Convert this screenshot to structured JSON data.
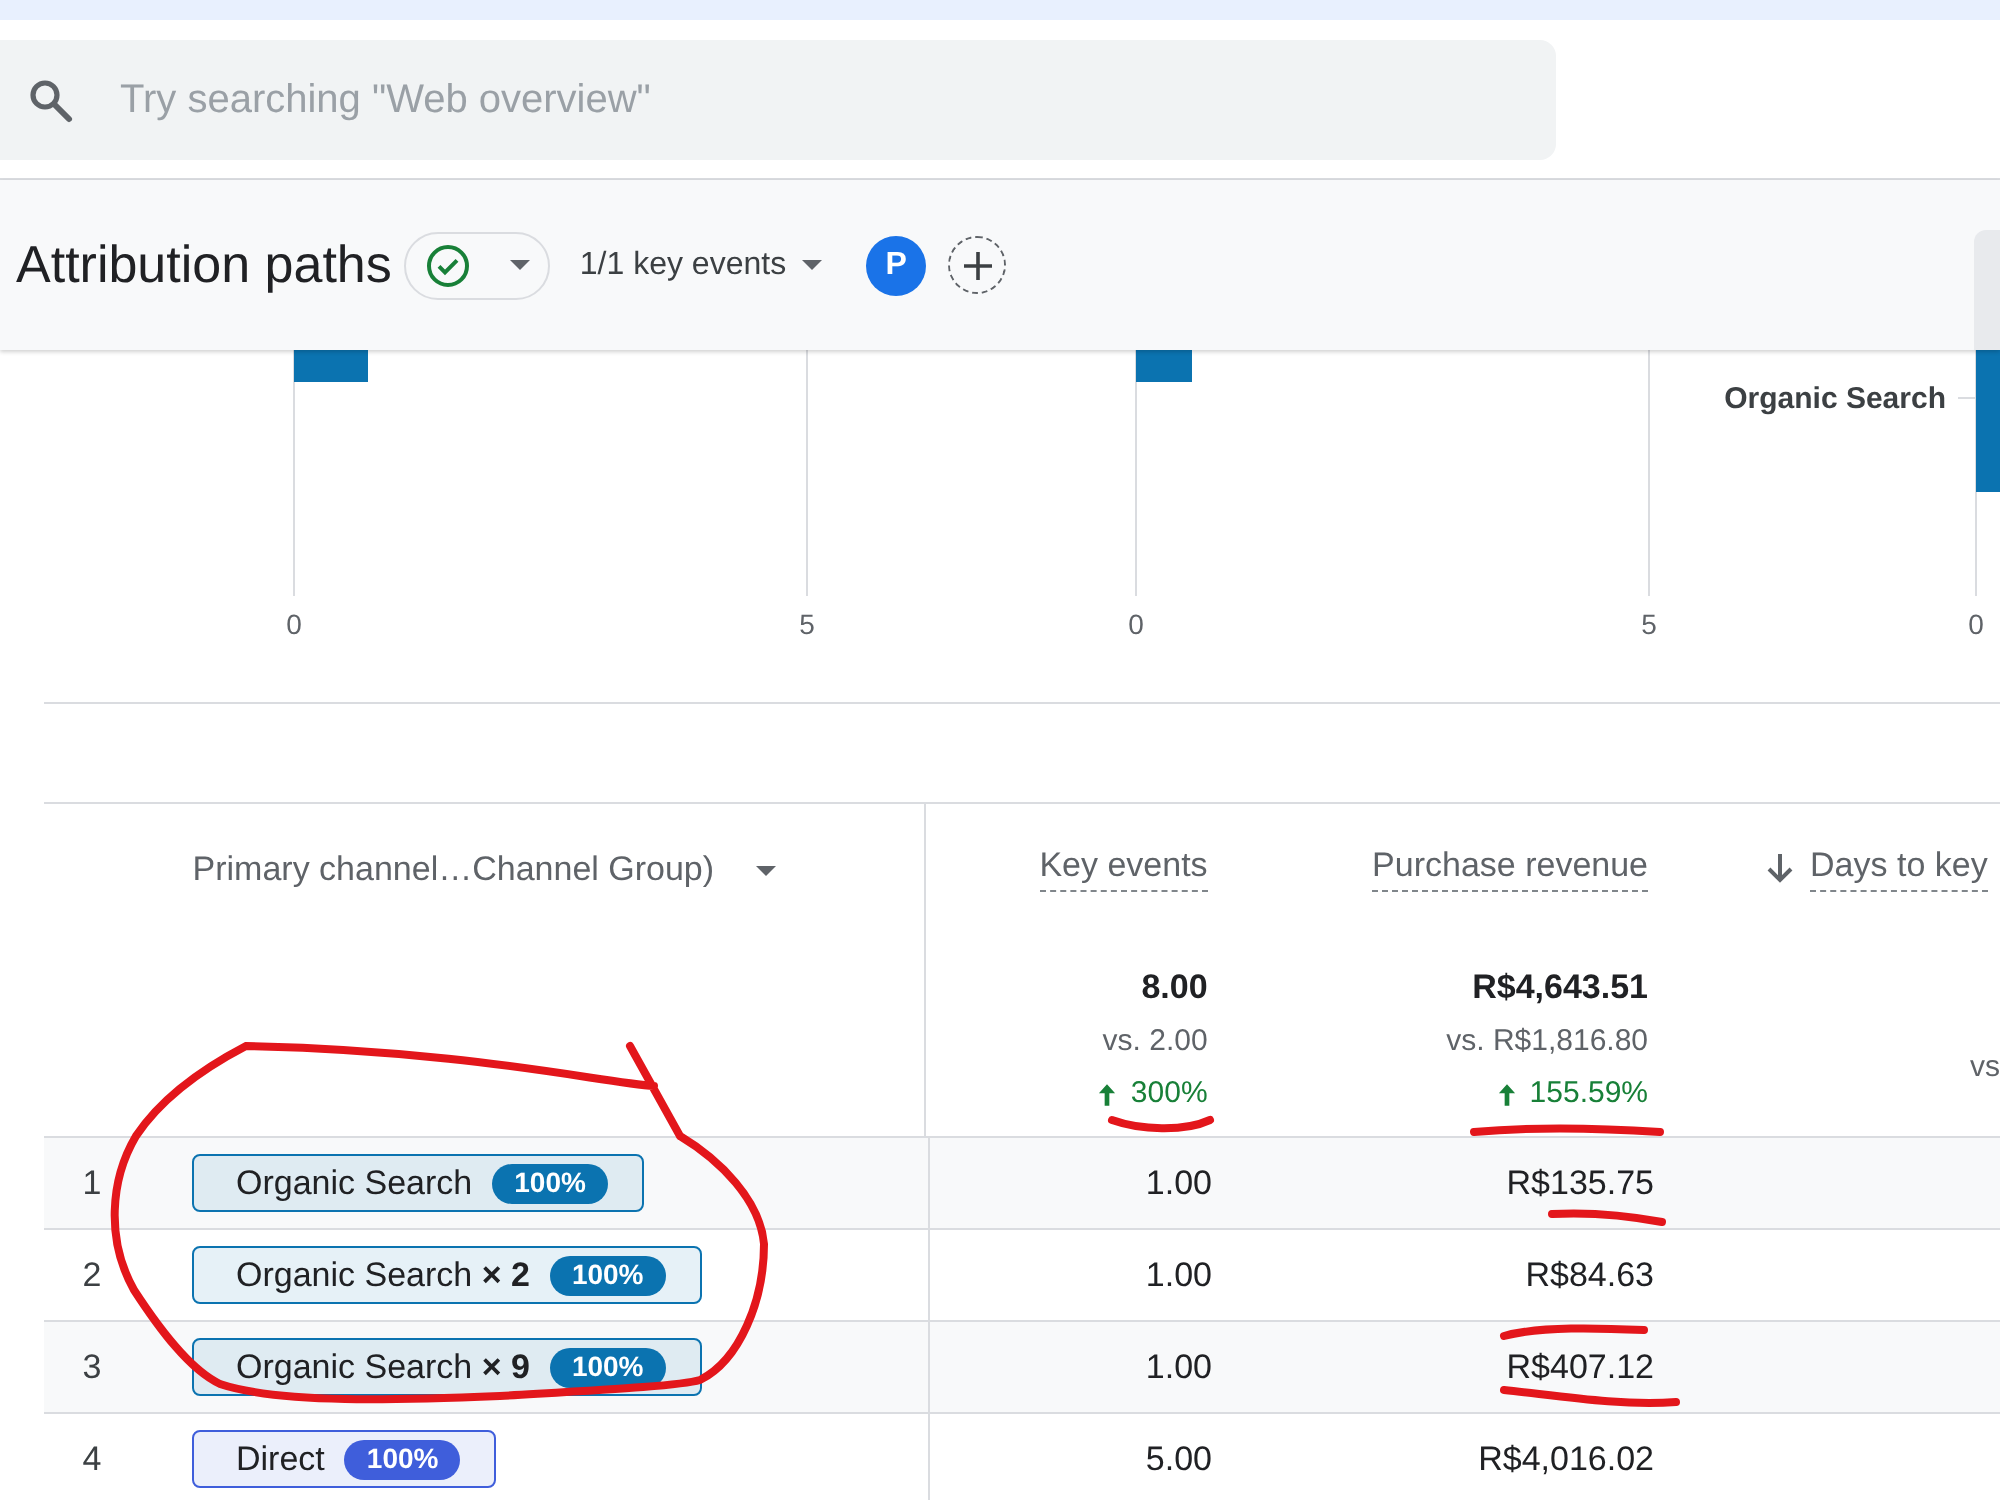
{
  "search": {
    "placeholder": "Try searching \"Web overview\""
  },
  "header": {
    "title": "Attribution paths",
    "key_events_filter": "1/1 key events",
    "comparison_avatar": "P"
  },
  "chart": {
    "panels": [
      {
        "ticks": [
          "0",
          "5"
        ]
      },
      {
        "ticks": [
          "0",
          "5"
        ]
      },
      {
        "ticks": [
          "0"
        ],
        "category_label": "Organic Search"
      }
    ]
  },
  "table": {
    "columns": [
      {
        "kind": "dimension",
        "label": "Primary channel…Channel Group)",
        "sorted": false
      },
      {
        "kind": "metric",
        "label": "Key events",
        "sorted": false,
        "total": {
          "value": "8.00",
          "compare": "vs. 2.00",
          "change": "300%",
          "increase": true
        }
      },
      {
        "kind": "metric",
        "label": "Purchase revenue",
        "sorted": false,
        "total": {
          "value": "R$4,643.51",
          "compare": "vs. R$1,816.80",
          "change": "155.59%",
          "increase": true
        }
      },
      {
        "kind": "metric",
        "label": "Days to key",
        "sorted": true,
        "total": {
          "compare": "vs"
        }
      }
    ],
    "rows": [
      {
        "index": "1",
        "path": [
          {
            "label": "Organic Search",
            "share": "100%",
            "color": "#0b73b0"
          }
        ],
        "key_events": "1.00",
        "revenue": "R$135.75"
      },
      {
        "index": "2",
        "path": [
          {
            "label": "Organic Search **× 2**",
            "share": "100%",
            "color": "#0b73b0"
          }
        ],
        "key_events": "1.00",
        "revenue": "R$84.63"
      },
      {
        "index": "3",
        "path": [
          {
            "label": "Organic Search **× 9**",
            "share": "100%",
            "color": "#0b73b0"
          }
        ],
        "key_events": "1.00",
        "revenue": "R$407.12"
      },
      {
        "index": "4",
        "path": [
          {
            "label": "Direct",
            "share": "100%",
            "color": "#3f5edb"
          }
        ],
        "key_events": "5.00",
        "revenue": "R$4,016.02"
      }
    ]
  }
}
